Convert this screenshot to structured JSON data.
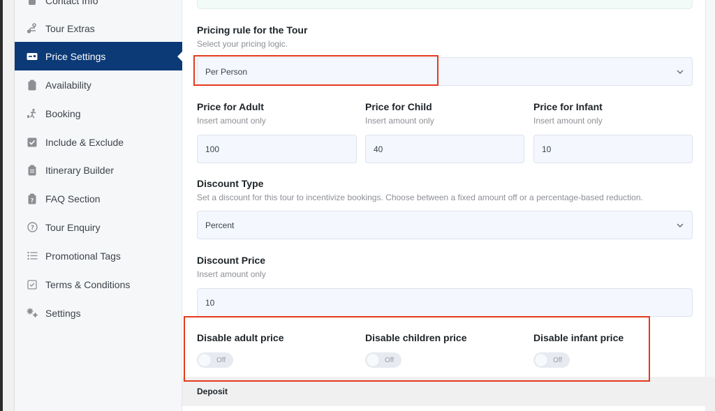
{
  "sidebar": {
    "items": [
      {
        "label": "Contact Info",
        "icon": "contact-icon",
        "active": false
      },
      {
        "label": "Tour Extras",
        "icon": "route-icon",
        "active": false
      },
      {
        "label": "Price Settings",
        "icon": "price-card-icon",
        "active": true
      },
      {
        "label": "Availability",
        "icon": "clipboard-icon",
        "active": false
      },
      {
        "label": "Booking",
        "icon": "walking-person-icon",
        "active": false
      },
      {
        "label": "Include & Exclude",
        "icon": "checkbox-icon",
        "active": false
      },
      {
        "label": "Itinerary Builder",
        "icon": "clipboard-list-icon",
        "active": false
      },
      {
        "label": "FAQ Section",
        "icon": "clipboard-question-icon",
        "active": false
      },
      {
        "label": "Tour Enquiry",
        "icon": "question-circle-icon",
        "active": false
      },
      {
        "label": "Promotional Tags",
        "icon": "list-icon",
        "active": false
      },
      {
        "label": "Terms & Conditions",
        "icon": "check-square-icon",
        "active": false
      },
      {
        "label": "Settings",
        "icon": "gears-icon",
        "active": false
      }
    ]
  },
  "pricing_rule": {
    "label": "Pricing rule for the Tour",
    "hint": "Select your pricing logic.",
    "value": "Per Person"
  },
  "prices": {
    "adult": {
      "label": "Price for Adult",
      "hint": "Insert amount only",
      "value": "100"
    },
    "child": {
      "label": "Price for Child",
      "hint": "Insert amount only",
      "value": "40"
    },
    "infant": {
      "label": "Price for Infant",
      "hint": "Insert amount only",
      "value": "10"
    }
  },
  "discount_type": {
    "label": "Discount Type",
    "hint": "Set a discount for this tour to incentivize bookings. Choose between a fixed amount off or a percentage-based reduction.",
    "value": "Percent"
  },
  "discount_price": {
    "label": "Discount Price",
    "hint": "Insert amount only",
    "value": "10"
  },
  "disable": {
    "adult": {
      "label": "Disable adult price",
      "state": "Off"
    },
    "children": {
      "label": "Disable children price",
      "state": "Off"
    },
    "infant": {
      "label": "Disable infant price",
      "state": "Off"
    }
  },
  "deposit": {
    "label": "Deposit"
  },
  "colors": {
    "accent": "#0b3a77",
    "highlight": "#e5391c"
  }
}
